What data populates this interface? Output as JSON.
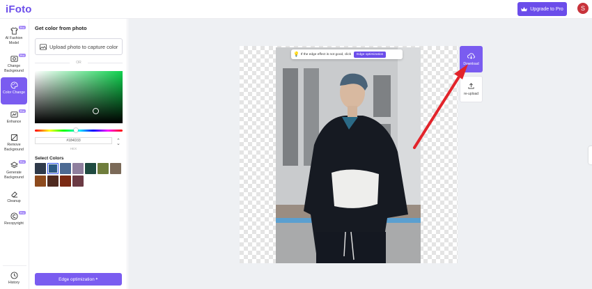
{
  "app": {
    "logo": "iFoto"
  },
  "header": {
    "upgrade_label": "Upgrade to Pro",
    "avatar_letter": "S"
  },
  "sidebar": {
    "items": [
      {
        "label": "AI Fashion Model",
        "icon": "shirt-icon",
        "pro": true,
        "active": false
      },
      {
        "label": "Change Background",
        "icon": "image-background-icon",
        "pro": true,
        "active": false
      },
      {
        "label": "Color Change",
        "icon": "palette-icon",
        "pro": false,
        "active": true
      },
      {
        "label": "Enhance",
        "icon": "enhance-icon",
        "pro": true,
        "active": false
      },
      {
        "label": "Remove Background",
        "icon": "remove-background-icon",
        "pro": false,
        "active": false
      },
      {
        "label": "Generate Background",
        "icon": "layers-icon",
        "pro": true,
        "active": false
      },
      {
        "label": "Cleanup",
        "icon": "eraser-icon",
        "pro": false,
        "active": false
      },
      {
        "label": "Recopyright",
        "icon": "copyright-icon",
        "pro": true,
        "active": false
      }
    ],
    "pro_badge": "Pro",
    "history_label": "History"
  },
  "panel": {
    "title": "Get color from photo",
    "upload_label": "Upload photo to capture color",
    "or_label": "OR",
    "hex_value": "#184D33",
    "hex_label": "HEX",
    "select_colors_title": "Select Colors",
    "swatches": [
      "#2f3a4a",
      "#2c5a85",
      "#4d6a93",
      "#8f7f9e",
      "#1f4a40",
      "#6f7d3c",
      "#7b6a58",
      "#8d4a1d",
      "#4f2a1f",
      "#7a2a14",
      "#6b3a44"
    ],
    "selected_swatch": 1,
    "edge_optimization_label": "Edge optimization",
    "edge_optimization_badge": "✦"
  },
  "canvas": {
    "tip_text": "If the edge effect is not good, click",
    "tip_button": "Edge optimization",
    "download_label": "Download",
    "reupload_label": "re-upload"
  },
  "colors": {
    "accent": "#7a5cf0",
    "accent_dark": "#6b4dea",
    "annotation_arrow": "#e2232a"
  }
}
